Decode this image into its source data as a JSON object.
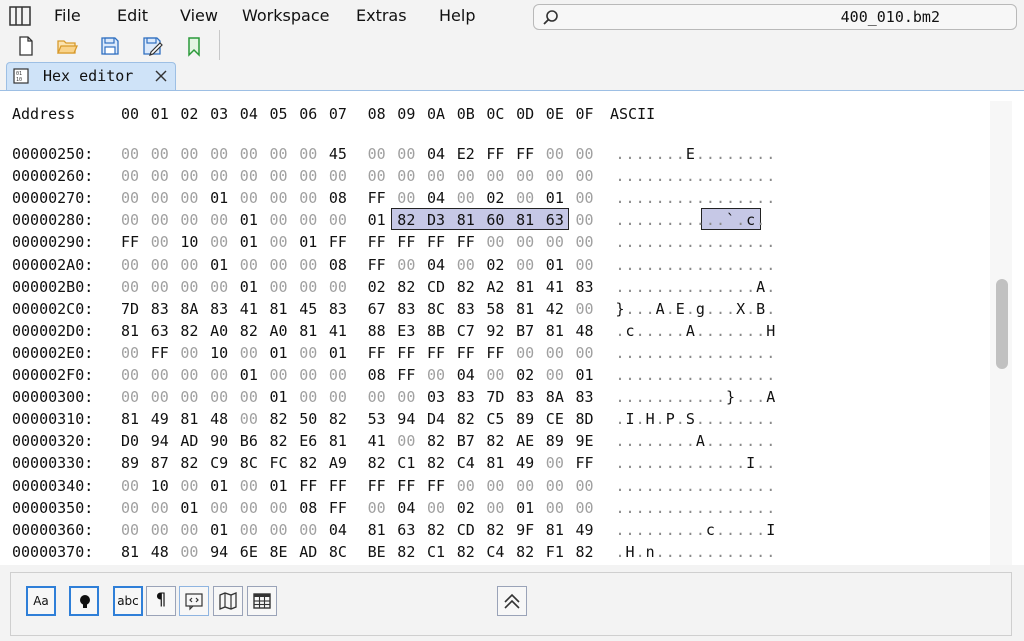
{
  "menubar": {
    "items": [
      "File",
      "Edit",
      "View",
      "Workspace",
      "Extras",
      "Help"
    ]
  },
  "search": {
    "value": "400_010.bm2"
  },
  "toolbar": {
    "icons": [
      "new-file-icon",
      "open-folder-icon",
      "save-icon",
      "save-as-icon",
      "bookmark-icon"
    ]
  },
  "tab": {
    "label": "Hex editor"
  },
  "hex": {
    "header": {
      "address": "Address",
      "columns": [
        "00",
        "01",
        "02",
        "03",
        "04",
        "05",
        "06",
        "07",
        "08",
        "09",
        "0A",
        "0B",
        "0C",
        "0D",
        "0E",
        "0F"
      ],
      "ascii": "ASCII"
    },
    "rows": [
      {
        "addr": "00000250:",
        "bytes": [
          "00",
          "00",
          "00",
          "00",
          "00",
          "00",
          "00",
          "45",
          "00",
          "00",
          "04",
          "E2",
          "FF",
          "FF",
          "00",
          "00"
        ],
        "ascii": ".......E........"
      },
      {
        "addr": "00000260:",
        "bytes": [
          "00",
          "00",
          "00",
          "00",
          "00",
          "00",
          "00",
          "00",
          "00",
          "00",
          "00",
          "00",
          "00",
          "00",
          "00",
          "00"
        ],
        "ascii": "................"
      },
      {
        "addr": "00000270:",
        "bytes": [
          "00",
          "00",
          "00",
          "01",
          "00",
          "00",
          "00",
          "08",
          "FF",
          "00",
          "04",
          "00",
          "02",
          "00",
          "01",
          "00"
        ],
        "ascii": "................"
      },
      {
        "addr": "00000280:",
        "bytes": [
          "00",
          "00",
          "00",
          "00",
          "01",
          "00",
          "00",
          "00",
          "01",
          "82",
          "D3",
          "81",
          "60",
          "81",
          "63",
          "00"
        ],
        "ascii": "...........`.c."
      },
      {
        "addr": "00000290:",
        "bytes": [
          "FF",
          "00",
          "10",
          "00",
          "01",
          "00",
          "01",
          "FF",
          "FF",
          "FF",
          "FF",
          "FF",
          "00",
          "00",
          "00",
          "00"
        ],
        "ascii": "................"
      },
      {
        "addr": "000002A0:",
        "bytes": [
          "00",
          "00",
          "00",
          "01",
          "00",
          "00",
          "00",
          "08",
          "FF",
          "00",
          "04",
          "00",
          "02",
          "00",
          "01",
          "00"
        ],
        "ascii": "................"
      },
      {
        "addr": "000002B0:",
        "bytes": [
          "00",
          "00",
          "00",
          "00",
          "01",
          "00",
          "00",
          "00",
          "02",
          "82",
          "CD",
          "82",
          "A2",
          "81",
          "41",
          "83"
        ],
        "ascii": "..............A."
      },
      {
        "addr": "000002C0:",
        "bytes": [
          "7D",
          "83",
          "8A",
          "83",
          "41",
          "81",
          "45",
          "83",
          "67",
          "83",
          "8C",
          "83",
          "58",
          "81",
          "42",
          "00"
        ],
        "ascii": "}...A.E.g...X.B."
      },
      {
        "addr": "000002D0:",
        "bytes": [
          "81",
          "63",
          "82",
          "A0",
          "82",
          "A0",
          "81",
          "41",
          "88",
          "E3",
          "8B",
          "C7",
          "92",
          "B7",
          "81",
          "48"
        ],
        "ascii": ".c.....A.......H"
      },
      {
        "addr": "000002E0:",
        "bytes": [
          "00",
          "FF",
          "00",
          "10",
          "00",
          "01",
          "00",
          "01",
          "FF",
          "FF",
          "FF",
          "FF",
          "FF",
          "00",
          "00",
          "00"
        ],
        "ascii": "................"
      },
      {
        "addr": "000002F0:",
        "bytes": [
          "00",
          "00",
          "00",
          "00",
          "01",
          "00",
          "00",
          "00",
          "08",
          "FF",
          "00",
          "04",
          "00",
          "02",
          "00",
          "01"
        ],
        "ascii": "................"
      },
      {
        "addr": "00000300:",
        "bytes": [
          "00",
          "00",
          "00",
          "00",
          "00",
          "01",
          "00",
          "00",
          "00",
          "00",
          "03",
          "83",
          "7D",
          "83",
          "8A",
          "83",
          "41"
        ],
        "ascii": "...........}...A"
      },
      {
        "addr": "00000310:",
        "bytes": [
          "81",
          "49",
          "81",
          "48",
          "00",
          "82",
          "50",
          "82",
          "53",
          "94",
          "D4",
          "82",
          "C5",
          "89",
          "CE",
          "8D"
        ],
        "ascii": ".I.H.P.S........"
      },
      {
        "addr": "00000320:",
        "bytes": [
          "D0",
          "94",
          "AD",
          "90",
          "B6",
          "82",
          "E6",
          "81",
          "41",
          "00",
          "82",
          "B7",
          "82",
          "AE",
          "89",
          "9E"
        ],
        "ascii": "........A......."
      },
      {
        "addr": "00000330:",
        "bytes": [
          "89",
          "87",
          "82",
          "C9",
          "8C",
          "FC",
          "82",
          "A9",
          "82",
          "C1",
          "82",
          "C4",
          "81",
          "49",
          "00",
          "FF"
        ],
        "ascii": ".............I.."
      },
      {
        "addr": "00000340:",
        "bytes": [
          "00",
          "10",
          "00",
          "01",
          "00",
          "01",
          "FF",
          "FF",
          "FF",
          "FF",
          "FF",
          "00",
          "00",
          "00",
          "00",
          "00"
        ],
        "ascii": "................"
      },
      {
        "addr": "00000350:",
        "bytes": [
          "00",
          "00",
          "01",
          "00",
          "00",
          "00",
          "08",
          "FF",
          "00",
          "04",
          "00",
          "02",
          "00",
          "01",
          "00",
          "00"
        ],
        "ascii": "................"
      },
      {
        "addr": "00000360:",
        "bytes": [
          "00",
          "00",
          "00",
          "01",
          "00",
          "00",
          "00",
          "04",
          "81",
          "63",
          "82",
          "CD",
          "82",
          "9F",
          "81",
          "49"
        ],
        "ascii": ".........c.....I"
      },
      {
        "addr": "00000370:",
        "bytes": [
          "81",
          "48",
          "00",
          "94",
          "6E",
          "8E",
          "AD",
          "8C",
          "BE",
          "82",
          "C1",
          "82",
          "C4",
          "82",
          "F1",
          "82"
        ],
        "ascii": ".H.n............"
      }
    ]
  },
  "bottom_panel": {
    "buttons": [
      {
        "name": "font-button",
        "label": "Aa",
        "on": true
      },
      {
        "name": "lightbulb-button",
        "label": "",
        "on": true
      },
      {
        "name": "spellcheck-button",
        "label": "abc",
        "on": true
      },
      {
        "name": "pilcrow-button",
        "label": "¶",
        "on": false
      },
      {
        "name": "code-tag-button",
        "label": "",
        "on": false
      },
      {
        "name": "map-button",
        "label": "",
        "on": false
      },
      {
        "name": "table-button",
        "label": "",
        "on": false
      }
    ],
    "collapse_icon": "double-chevron-up-icon"
  },
  "colors": {
    "accent": "#2f7fd8",
    "selection": "#c6c8e6",
    "tab": "#cfe3f8"
  }
}
